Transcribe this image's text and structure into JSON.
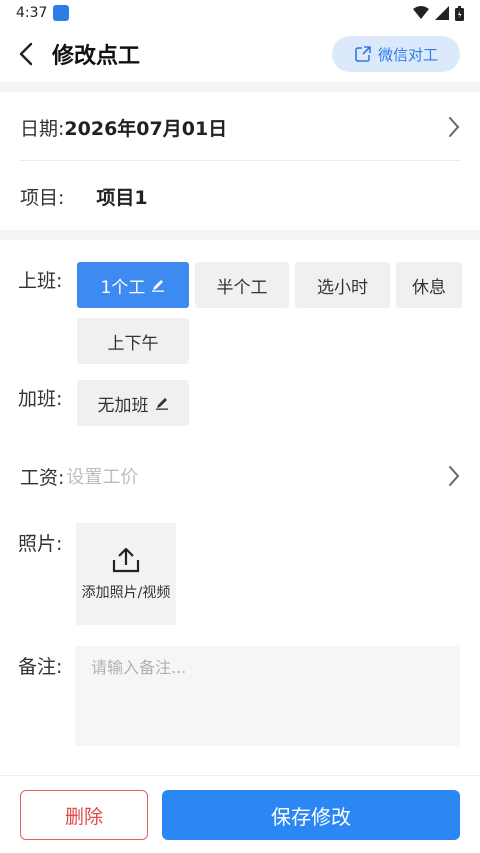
{
  "status_bar": {
    "time": "4:37"
  },
  "header": {
    "title": "修改点工",
    "wechat_button": "微信对工"
  },
  "date": {
    "label": "日期:",
    "value": "2026年07月01日"
  },
  "project": {
    "label": "项目:",
    "value": "项目1"
  },
  "shift": {
    "label": "上班:",
    "options": [
      "1个工",
      "半个工",
      "选小时",
      "休息",
      "上下午"
    ],
    "selected": "1个工"
  },
  "overtime": {
    "label": "加班:",
    "value": "无加班"
  },
  "wage": {
    "label": "工资:",
    "placeholder": "设置工价"
  },
  "photo": {
    "label": "照片:",
    "add_text": "添加照片/视频"
  },
  "remark": {
    "label": "备注:",
    "placeholder": "请输入备注..."
  },
  "footer": {
    "delete_label": "删除",
    "save_label": "保存修改"
  },
  "colors": {
    "accent": "#2b87f3",
    "danger": "#e04848",
    "chip_bg": "#f0f0f0"
  },
  "icons": [
    "back-arrow-icon",
    "share-icon",
    "chevron-right-icon",
    "edit-pencil-icon",
    "upload-icon",
    "wifi-icon",
    "signal-icon",
    "battery-icon"
  ]
}
